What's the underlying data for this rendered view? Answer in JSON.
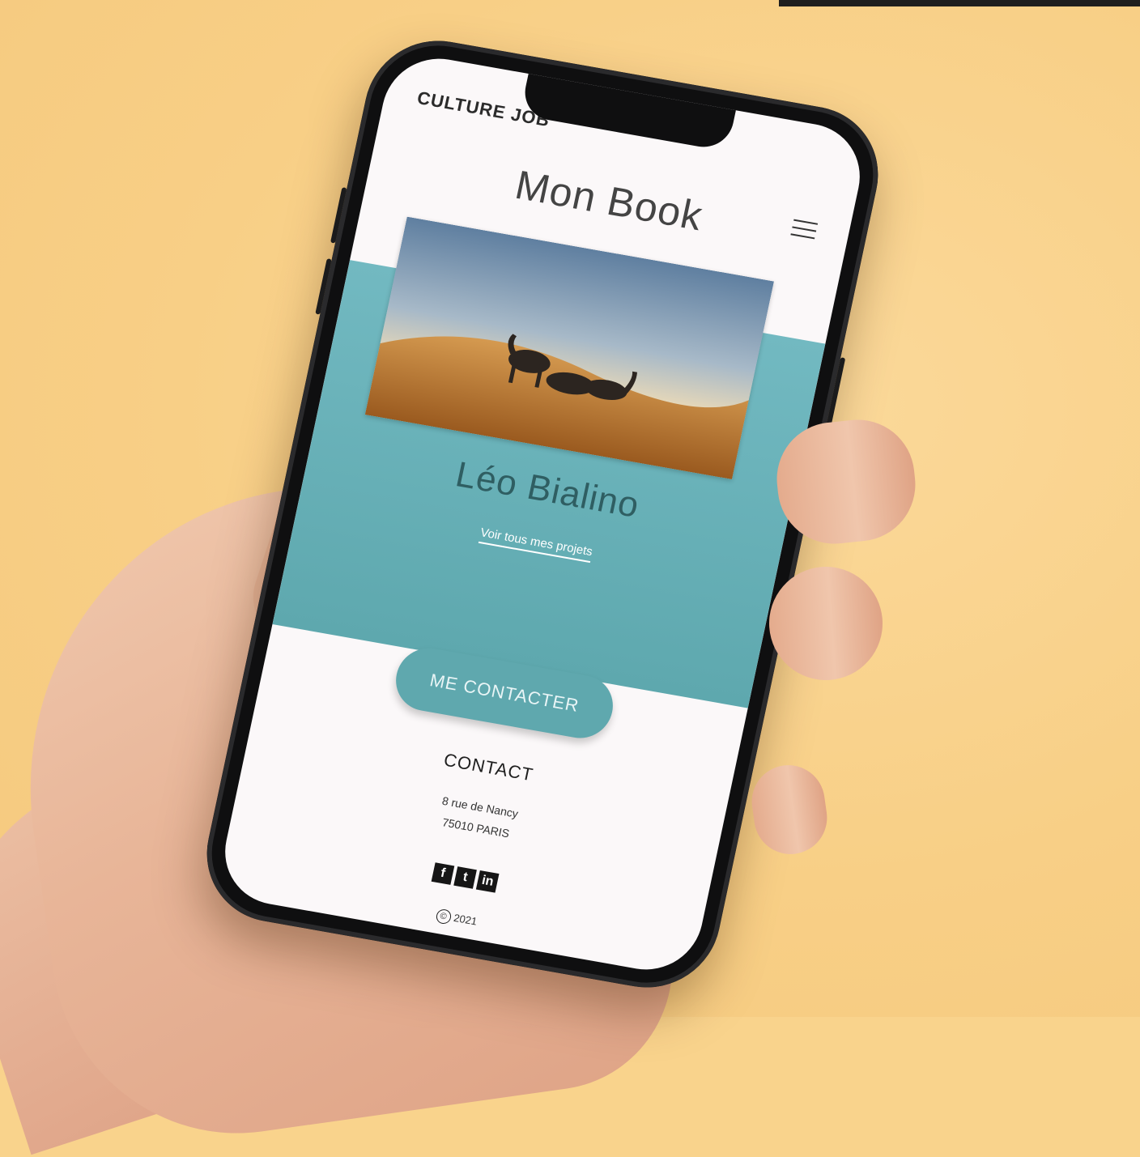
{
  "header": {
    "brand": "CULTURE JOB",
    "menu_icon": "hamburger-menu-icon"
  },
  "page": {
    "title": "Mon Book"
  },
  "profile": {
    "name": "Léo Bialino",
    "projects_link": "Voir tous mes projets",
    "photo_alt": "desert-camels-photo"
  },
  "cta": {
    "contact_button": "ME CONTACTER"
  },
  "footer": {
    "contact_heading": "CONTACT",
    "address_line1": "8 rue de Nancy",
    "address_line2": "75010 PARIS",
    "social": {
      "facebook": "f",
      "twitter": "t",
      "linkedin": "in"
    },
    "copyright_year": "2021",
    "copyright_symbol": "©"
  },
  "colors": {
    "background": "#f9d38c",
    "teal": "#5fa8ae",
    "screen": "#fbf8f9"
  }
}
